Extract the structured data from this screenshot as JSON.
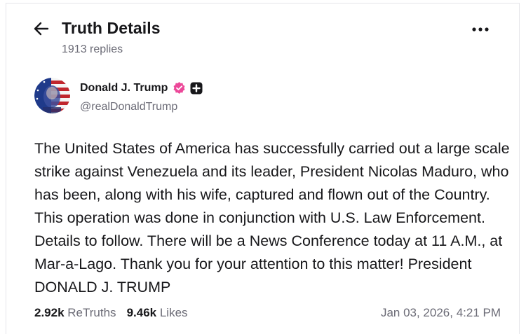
{
  "header": {
    "title": "Truth Details",
    "replies": "1913 replies",
    "back_icon": "arrow-left-icon",
    "more_icon": "more-horizontal-icon"
  },
  "author": {
    "name": "Donald J. Trump",
    "handle": "@realDonaldTrump",
    "verified_icon": "verified-badge-icon",
    "plus_icon": "plus-badge-icon",
    "verified_color": "#ec4899"
  },
  "post": {
    "text": "The United States of America has successfully carried out a large scale strike against Venezuela and its leader, President Nicolas Maduro, who has been, along with his wife, captured and flown out of the Country. This operation was done in conjunction with U.S. Law Enforcement. Details to follow. There will be a News Conference today at 11 A.M., at Mar-a-Lago. Thank you for your attention to this matter! President DONALD J. TRUMP"
  },
  "stats": {
    "retruths_count": "2.92k",
    "retruths_label": "ReTruths",
    "likes_count": "9.46k",
    "likes_label": "Likes",
    "timestamp": "Jan 03, 2026, 4:21 PM"
  }
}
